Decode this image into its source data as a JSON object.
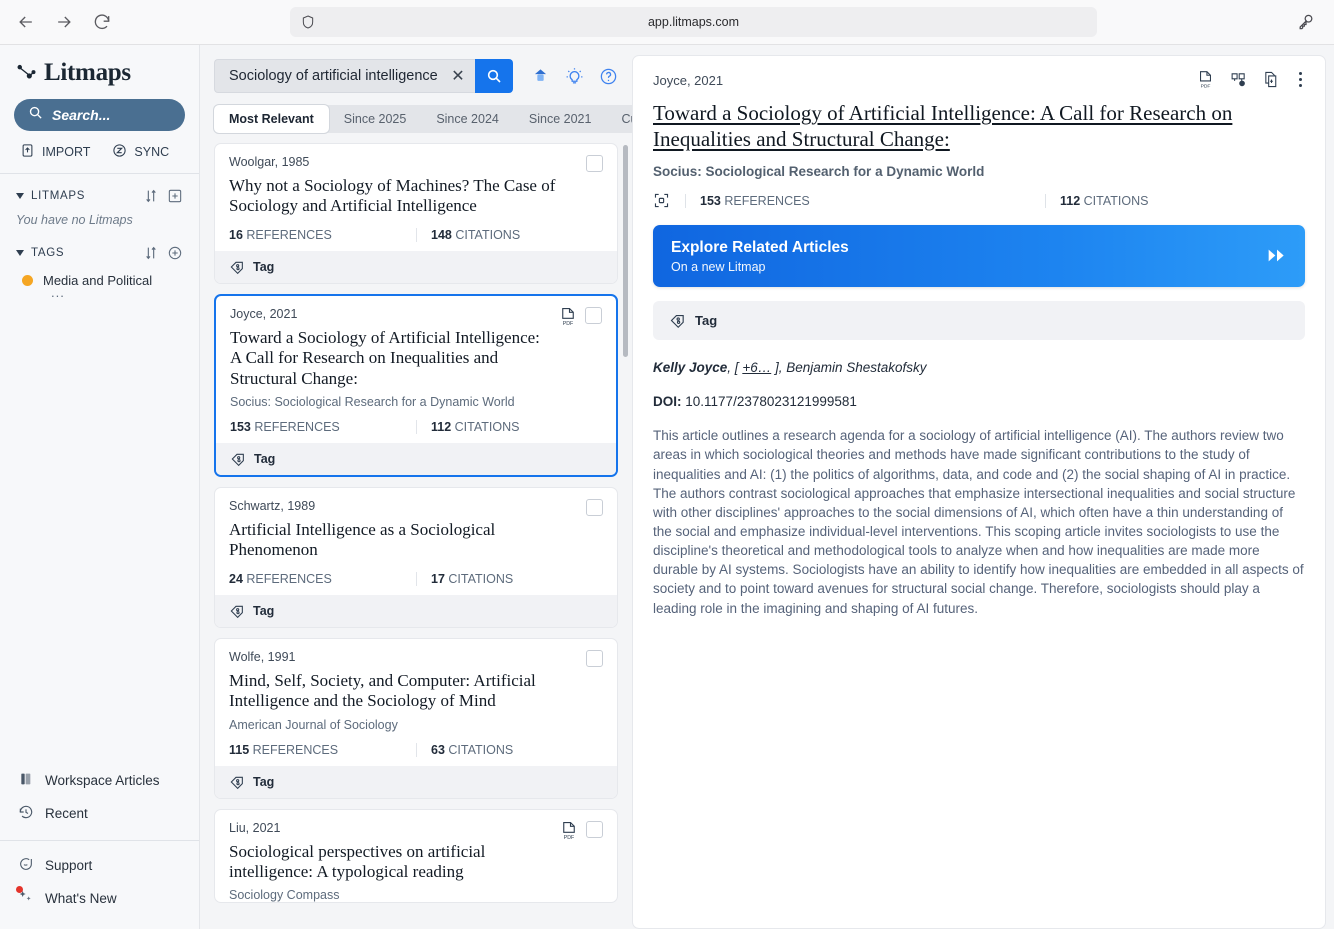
{
  "browser": {
    "url": "app.litmaps.com",
    "back_icon": "back-arrow-icon",
    "forward_icon": "forward-arrow-icon",
    "reload_icon": "reload-icon",
    "shield_icon": "shield-icon",
    "extension_icon": "key-icon"
  },
  "sidebar": {
    "brand": "Litmaps",
    "search_placeholder": "Search...",
    "actions": [
      {
        "label": "IMPORT",
        "icon": "import-icon"
      },
      {
        "label": "SYNC",
        "icon": "zotero-sync-icon"
      }
    ],
    "litmaps": {
      "title": "LITMAPS",
      "empty_text": "You have no Litmaps",
      "sort_icon": "sort-icon",
      "add_icon": "add-square-icon"
    },
    "tags": {
      "title": "TAGS",
      "sort_icon": "sort-icon",
      "add_icon": "add-circle-icon",
      "items": [
        {
          "label": "Media and Political",
          "color": "#f5a623"
        }
      ],
      "overflow": "..."
    },
    "bottom": [
      {
        "label": "Workspace Articles",
        "icon": "library-icon"
      },
      {
        "label": "Recent",
        "icon": "history-icon"
      }
    ],
    "footer": [
      {
        "label": "Support",
        "icon": "chat-icon",
        "badge": false
      },
      {
        "label": "What's New",
        "icon": "sparkle-icon",
        "badge": true
      }
    ]
  },
  "search": {
    "value": "Sociology of artificial intelligence",
    "placeholder": "Search...",
    "clear_label": "✕",
    "go_icon": "magnifier-icon",
    "top_icons": [
      {
        "name": "new-litmap-icon"
      },
      {
        "name": "lightbulb-icon"
      },
      {
        "name": "help-circle-icon"
      }
    ]
  },
  "filters": {
    "tabs": [
      {
        "label": "Most Relevant",
        "active": true
      },
      {
        "label": "Since 2025",
        "active": false
      },
      {
        "label": "Since 2024",
        "active": false
      },
      {
        "label": "Since 2021",
        "active": false
      },
      {
        "label": "Custom",
        "active": false
      }
    ]
  },
  "results": {
    "tag_label": "Tag",
    "references_label": "REFERENCES",
    "citations_label": "CITATIONS",
    "items": [
      {
        "author": "Woolgar, 1985",
        "title": "Why not a Sociology of Machines? The Case of Sociology and Artificial Intelligence",
        "journal": "",
        "references": "16",
        "citations": "148",
        "has_pdf": false,
        "selected": false
      },
      {
        "author": "Joyce, 2021",
        "title": "Toward a Sociology of Artificial Intelligence: A Call for Research on Inequalities and Structural Change:",
        "journal": "Socius: Sociological Research for a Dynamic World",
        "references": "153",
        "citations": "112",
        "has_pdf": true,
        "selected": true
      },
      {
        "author": "Schwartz, 1989",
        "title": "Artificial Intelligence as a Sociological Phenomenon",
        "journal": "",
        "references": "24",
        "citations": "17",
        "has_pdf": false,
        "selected": false
      },
      {
        "author": "Wolfe, 1991",
        "title": "Mind, Self, Society, and Computer: Artificial Intelligence and the Sociology of Mind",
        "journal": "American Journal of Sociology",
        "references": "115",
        "citations": "63",
        "has_pdf": false,
        "selected": false
      },
      {
        "author": "Liu, 2021",
        "title": "Sociological perspectives on artificial intelligence: A typological reading",
        "journal": "Sociology Compass",
        "references": "",
        "citations": "",
        "has_pdf": true,
        "selected": false
      }
    ]
  },
  "detail": {
    "author": "Joyce, 2021",
    "title": "Toward a Sociology of Artificial Intelligence: A Call for Research on Inequalities and Structural Change:",
    "journal": "Socius: Sociological Research for a Dynamic World",
    "references": "153",
    "references_label": "REFERENCES",
    "citations": "112",
    "citations_label": "CITATIONS",
    "explore_title": "Explore Related Articles",
    "explore_sub": "On a new Litmap",
    "tag_label": "Tag",
    "authors_lead": "Kelly Joyce",
    "authors_more": "+6…",
    "authors_rest": "Benjamin Shestakofsky",
    "doi_label": "DOI:",
    "doi_value": "10.1177/2378023121999581",
    "abstract": "This article outlines a research agenda for a sociology of artificial intelligence (AI). The authors review two areas in which sociological theories and methods have made significant contributions to the study of inequalities and AI: (1) the politics of algorithms, data, and code and (2) the social shaping of AI in practice. The authors contrast sociological approaches that emphasize intersectional inequalities and social structure with other disciplines' approaches to the social dimensions of AI, which often have a thin understanding of the social and emphasize individual-level interventions. This scoping article invites sociologists to use the discipline's theoretical and methodological tools to analyze when and how inequalities are made more durable by AI systems. Sociologists have an ability to identify how inequalities are embedded in all aspects of society and to point toward avenues for structural social change. Therefore, sociologists should play a leading role in the imagining and shaping of AI futures.",
    "icons": [
      {
        "name": "pdf-icon"
      },
      {
        "name": "cite-icon"
      },
      {
        "name": "copy-doc-icon"
      },
      {
        "name": "more-options-icon"
      }
    ]
  },
  "colors": {
    "accent_blue": "#1574ec",
    "sidebar_search": "#4a6f91",
    "tag_orange": "#f5a623",
    "notification_red": "#e4342b"
  }
}
